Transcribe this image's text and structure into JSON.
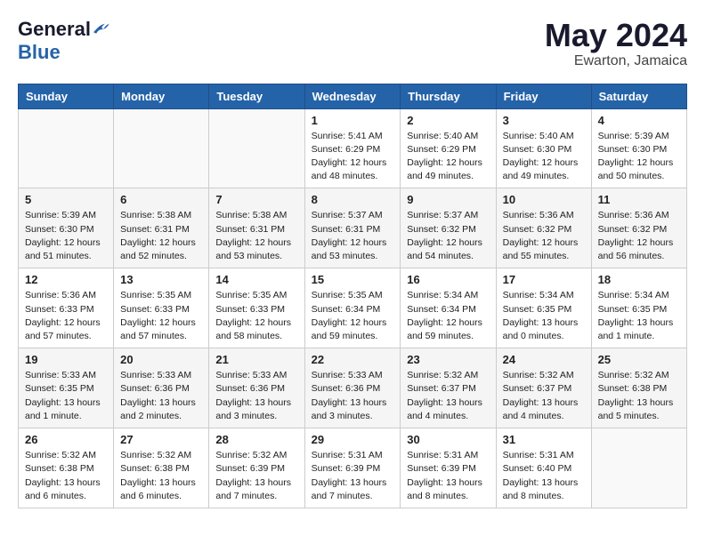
{
  "header": {
    "logo_general": "General",
    "logo_blue": "Blue",
    "month": "May 2024",
    "location": "Ewarton, Jamaica"
  },
  "days_of_week": [
    "Sunday",
    "Monday",
    "Tuesday",
    "Wednesday",
    "Thursday",
    "Friday",
    "Saturday"
  ],
  "weeks": [
    [
      {
        "day": "",
        "info": ""
      },
      {
        "day": "",
        "info": ""
      },
      {
        "day": "",
        "info": ""
      },
      {
        "day": "1",
        "info": "Sunrise: 5:41 AM\nSunset: 6:29 PM\nDaylight: 12 hours and 48 minutes."
      },
      {
        "day": "2",
        "info": "Sunrise: 5:40 AM\nSunset: 6:29 PM\nDaylight: 12 hours and 49 minutes."
      },
      {
        "day": "3",
        "info": "Sunrise: 5:40 AM\nSunset: 6:30 PM\nDaylight: 12 hours and 49 minutes."
      },
      {
        "day": "4",
        "info": "Sunrise: 5:39 AM\nSunset: 6:30 PM\nDaylight: 12 hours and 50 minutes."
      }
    ],
    [
      {
        "day": "5",
        "info": "Sunrise: 5:39 AM\nSunset: 6:30 PM\nDaylight: 12 hours and 51 minutes."
      },
      {
        "day": "6",
        "info": "Sunrise: 5:38 AM\nSunset: 6:31 PM\nDaylight: 12 hours and 52 minutes."
      },
      {
        "day": "7",
        "info": "Sunrise: 5:38 AM\nSunset: 6:31 PM\nDaylight: 12 hours and 53 minutes."
      },
      {
        "day": "8",
        "info": "Sunrise: 5:37 AM\nSunset: 6:31 PM\nDaylight: 12 hours and 53 minutes."
      },
      {
        "day": "9",
        "info": "Sunrise: 5:37 AM\nSunset: 6:32 PM\nDaylight: 12 hours and 54 minutes."
      },
      {
        "day": "10",
        "info": "Sunrise: 5:36 AM\nSunset: 6:32 PM\nDaylight: 12 hours and 55 minutes."
      },
      {
        "day": "11",
        "info": "Sunrise: 5:36 AM\nSunset: 6:32 PM\nDaylight: 12 hours and 56 minutes."
      }
    ],
    [
      {
        "day": "12",
        "info": "Sunrise: 5:36 AM\nSunset: 6:33 PM\nDaylight: 12 hours and 57 minutes."
      },
      {
        "day": "13",
        "info": "Sunrise: 5:35 AM\nSunset: 6:33 PM\nDaylight: 12 hours and 57 minutes."
      },
      {
        "day": "14",
        "info": "Sunrise: 5:35 AM\nSunset: 6:33 PM\nDaylight: 12 hours and 58 minutes."
      },
      {
        "day": "15",
        "info": "Sunrise: 5:35 AM\nSunset: 6:34 PM\nDaylight: 12 hours and 59 minutes."
      },
      {
        "day": "16",
        "info": "Sunrise: 5:34 AM\nSunset: 6:34 PM\nDaylight: 12 hours and 59 minutes."
      },
      {
        "day": "17",
        "info": "Sunrise: 5:34 AM\nSunset: 6:35 PM\nDaylight: 13 hours and 0 minutes."
      },
      {
        "day": "18",
        "info": "Sunrise: 5:34 AM\nSunset: 6:35 PM\nDaylight: 13 hours and 1 minute."
      }
    ],
    [
      {
        "day": "19",
        "info": "Sunrise: 5:33 AM\nSunset: 6:35 PM\nDaylight: 13 hours and 1 minute."
      },
      {
        "day": "20",
        "info": "Sunrise: 5:33 AM\nSunset: 6:36 PM\nDaylight: 13 hours and 2 minutes."
      },
      {
        "day": "21",
        "info": "Sunrise: 5:33 AM\nSunset: 6:36 PM\nDaylight: 13 hours and 3 minutes."
      },
      {
        "day": "22",
        "info": "Sunrise: 5:33 AM\nSunset: 6:36 PM\nDaylight: 13 hours and 3 minutes."
      },
      {
        "day": "23",
        "info": "Sunrise: 5:32 AM\nSunset: 6:37 PM\nDaylight: 13 hours and 4 minutes."
      },
      {
        "day": "24",
        "info": "Sunrise: 5:32 AM\nSunset: 6:37 PM\nDaylight: 13 hours and 4 minutes."
      },
      {
        "day": "25",
        "info": "Sunrise: 5:32 AM\nSunset: 6:38 PM\nDaylight: 13 hours and 5 minutes."
      }
    ],
    [
      {
        "day": "26",
        "info": "Sunrise: 5:32 AM\nSunset: 6:38 PM\nDaylight: 13 hours and 6 minutes."
      },
      {
        "day": "27",
        "info": "Sunrise: 5:32 AM\nSunset: 6:38 PM\nDaylight: 13 hours and 6 minutes."
      },
      {
        "day": "28",
        "info": "Sunrise: 5:32 AM\nSunset: 6:39 PM\nDaylight: 13 hours and 7 minutes."
      },
      {
        "day": "29",
        "info": "Sunrise: 5:31 AM\nSunset: 6:39 PM\nDaylight: 13 hours and 7 minutes."
      },
      {
        "day": "30",
        "info": "Sunrise: 5:31 AM\nSunset: 6:39 PM\nDaylight: 13 hours and 8 minutes."
      },
      {
        "day": "31",
        "info": "Sunrise: 5:31 AM\nSunset: 6:40 PM\nDaylight: 13 hours and 8 minutes."
      },
      {
        "day": "",
        "info": ""
      }
    ]
  ]
}
